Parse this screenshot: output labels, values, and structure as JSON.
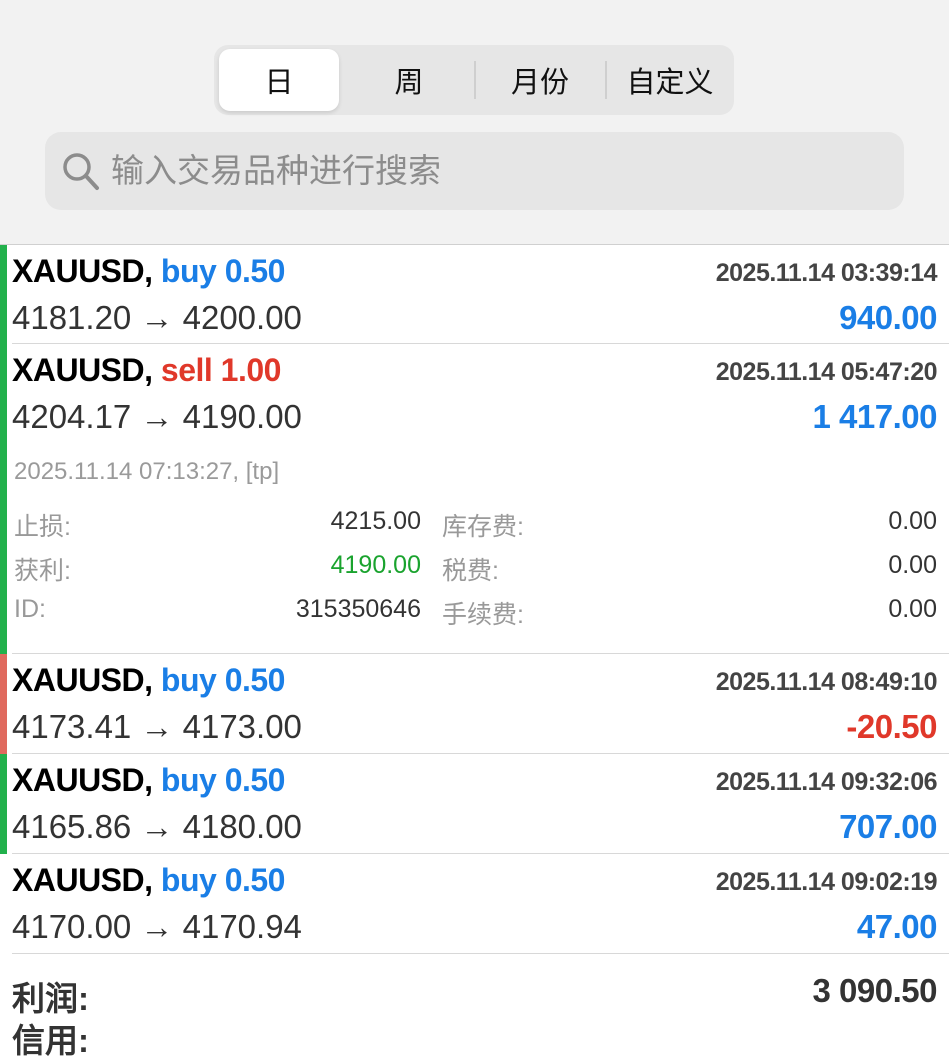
{
  "period_tabs": [
    {
      "label": "日",
      "active": true
    },
    {
      "label": "周",
      "active": false
    },
    {
      "label": "月份",
      "active": false
    },
    {
      "label": "自定义",
      "active": false
    }
  ],
  "search": {
    "placeholder": "输入交易品种进行搜索",
    "icon": "search-icon"
  },
  "colors": {
    "buy": "#1a7ee6",
    "sell": "#e0382a",
    "profit_bar": "#22b14c",
    "loss_bar": "#e06a5e"
  },
  "trades": [
    {
      "symbol": "XAUUSD,",
      "side": "buy 0.50",
      "type": "buy",
      "time": "2025.11.14 03:39:14",
      "prices": "4181.20 → 4200.00",
      "profit": "940.00",
      "result": "profit"
    },
    {
      "symbol": "XAUUSD,",
      "side": "sell 1.00",
      "type": "sell",
      "time": "2025.11.14 05:47:20",
      "prices": "4204.17 → 4190.00",
      "profit": "1 417.00",
      "result": "profit",
      "details": {
        "close_time": "2025.11.14 07:13:27, [tp]",
        "sl_label": "止损:",
        "sl_value": "4215.00",
        "swap_label": "库存费:",
        "swap_value": "0.00",
        "tp_label": "获利:",
        "tp_value": "4190.00",
        "tax_label": "税费:",
        "tax_value": "0.00",
        "id_label": "ID:",
        "id_value": "315350646",
        "commission_label": "手续费:",
        "commission_value": "0.00"
      }
    },
    {
      "symbol": "XAUUSD,",
      "side": "buy 0.50",
      "type": "buy",
      "time": "2025.11.14 08:49:10",
      "prices": "4173.41 → 4173.00",
      "profit": "-20.50",
      "result": "loss"
    },
    {
      "symbol": "XAUUSD,",
      "side": "buy 0.50",
      "type": "buy",
      "time": "2025.11.14 09:32:06",
      "prices": "4165.86 → 4180.00",
      "profit": "707.00",
      "result": "profit"
    },
    {
      "symbol": "XAUUSD,",
      "side": "buy 0.50",
      "type": "buy",
      "time": "2025.11.14 09:02:19",
      "prices": "4170.00 → 4170.94",
      "profit": "47.00",
      "result": "none"
    }
  ],
  "summary": {
    "profit_label": "利润:",
    "profit_value": "3 090.50",
    "next_label": "信用:"
  }
}
